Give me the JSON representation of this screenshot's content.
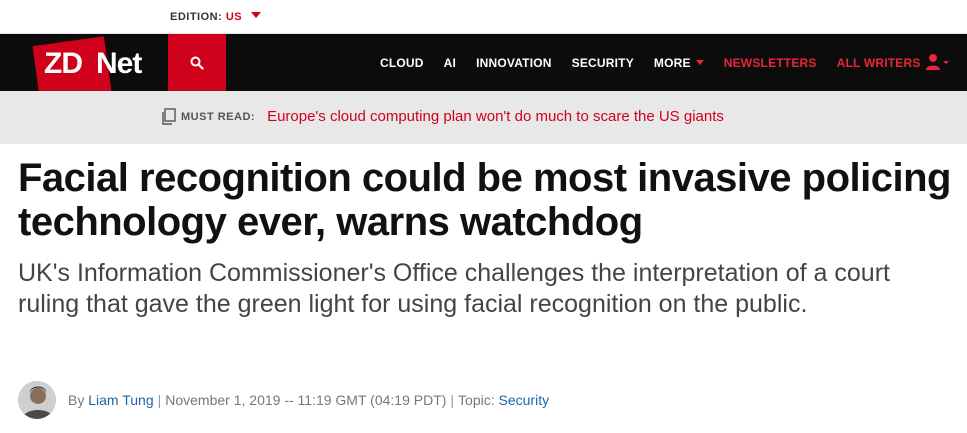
{
  "edition": {
    "label": "EDITION:",
    "value": "US"
  },
  "brand": {
    "zd": "ZD",
    "net": "Net"
  },
  "nav": {
    "links": [
      "CLOUD",
      "AI",
      "INNOVATION",
      "SECURITY",
      "MORE"
    ],
    "newsletters": "NEWSLETTERS",
    "all_writers": "ALL WRITERS"
  },
  "must_read": {
    "label": "MUST READ:",
    "link": "Europe's cloud computing plan won't do much to scare the US giants"
  },
  "article": {
    "headline": "Facial recognition could be most invasive policing technology ever, warns watchdog",
    "subhead": "UK's Information Commissioner's Office challenges the interpretation of a court ruling that gave the green light for using facial recognition on the public.",
    "byline": {
      "by": "By",
      "author": "Liam Tung",
      "sep1": "|",
      "date": "November 1, 2019 -- 11:19 GMT (04:19 PDT)",
      "sep2": "|",
      "topic_label": "Topic:",
      "topic": "Security"
    }
  },
  "colors": {
    "brand_red": "#d0021b",
    "nav_bg": "#0c0c0c",
    "must_read_bg": "#e8e8e8",
    "link_blue": "#1f64a8"
  }
}
